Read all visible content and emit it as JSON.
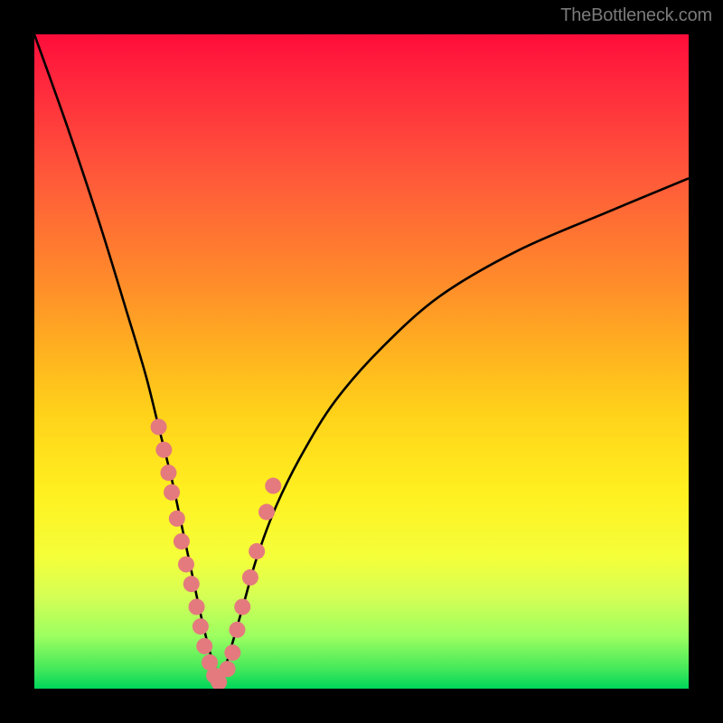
{
  "watermark": "TheBottleneck.com",
  "chart_data": {
    "type": "line",
    "title": "",
    "xlabel": "",
    "ylabel": "",
    "xlim": [
      0,
      100
    ],
    "ylim": [
      0,
      100
    ],
    "curve_left": {
      "name": "left-arm",
      "x": [
        0,
        5,
        10,
        14,
        17,
        19,
        21,
        22.5,
        24,
        25.5,
        27,
        28.5
      ],
      "y": [
        100,
        86,
        71,
        58,
        48,
        40,
        32,
        25,
        18,
        11,
        5,
        1
      ]
    },
    "curve_right": {
      "name": "right-arm",
      "x": [
        28.5,
        30,
        32,
        34,
        37,
        41,
        46,
        53,
        62,
        74,
        88,
        100
      ],
      "y": [
        1,
        6,
        13,
        20,
        28,
        36,
        44,
        52,
        60,
        67,
        73,
        78
      ]
    },
    "scatter_left": {
      "name": "left-dots",
      "x": [
        19.0,
        19.8,
        20.5,
        21.0,
        21.8,
        22.5,
        23.2,
        24.0,
        24.8,
        25.4,
        26.0,
        26.8,
        27.5,
        28.2
      ],
      "y": [
        40.0,
        36.5,
        33.0,
        30.0,
        26.0,
        22.5,
        19.0,
        16.0,
        12.5,
        9.5,
        6.5,
        4.0,
        2.0,
        1.0
      ]
    },
    "scatter_right": {
      "name": "right-dots",
      "x": [
        29.5,
        30.3,
        31.0,
        31.8,
        33.0,
        34.0,
        35.5,
        36.5
      ],
      "y": [
        3.0,
        5.5,
        9.0,
        12.5,
        17.0,
        21.0,
        27.0,
        31.0
      ]
    },
    "dot_color": "#e47a7e",
    "dot_radius": 9
  }
}
